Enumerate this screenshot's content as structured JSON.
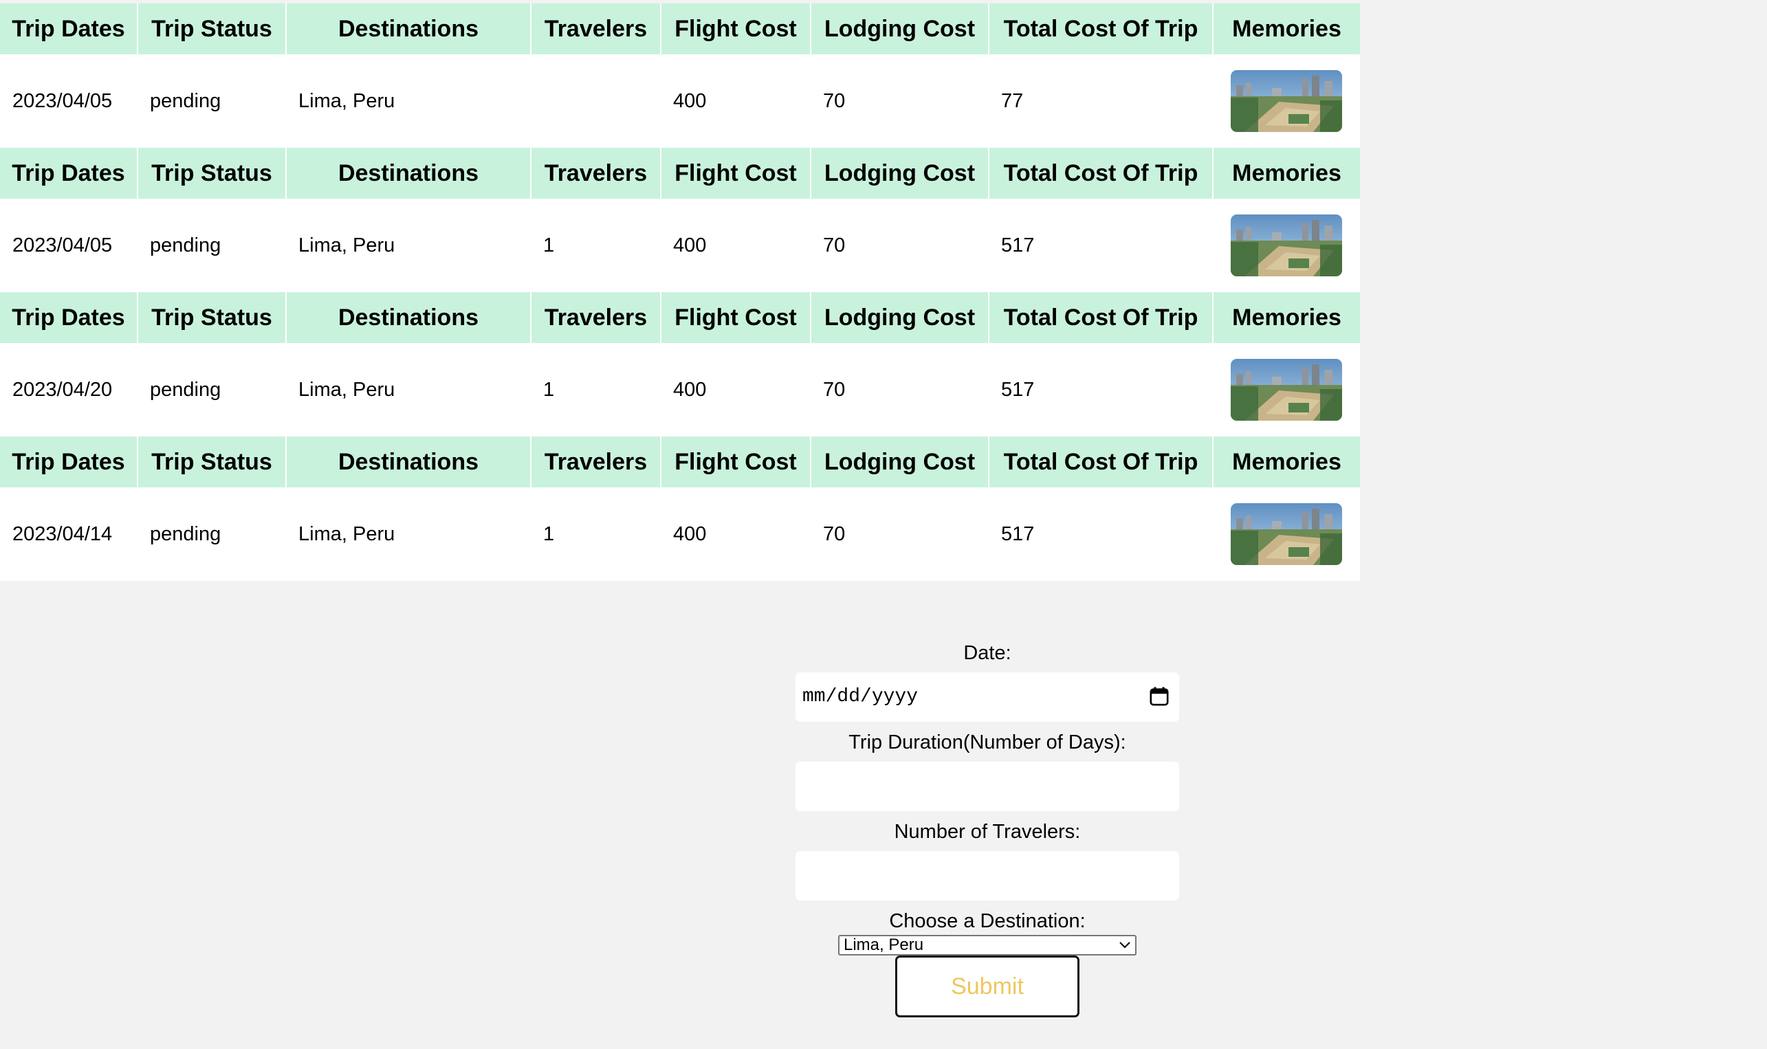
{
  "trips": {
    "headers": {
      "trip_dates": "Trip Dates",
      "trip_status": "Trip Status",
      "destinations": "Destinations",
      "travelers": "Travelers",
      "flight_cost": "Flight Cost",
      "lodging_cost": "Lodging Cost",
      "total_cost": "Total Cost Of Trip",
      "memories": "Memories"
    },
    "rows": [
      {
        "date": "2023/04/05",
        "status": "pending",
        "destination": "Lima, Peru",
        "travelers": "",
        "flight_cost": "400",
        "lodging_cost": "70",
        "total_cost": "77",
        "memory_image": "lima-city-aerial-photo"
      },
      {
        "date": "2023/04/05",
        "status": "pending",
        "destination": "Lima, Peru",
        "travelers": "1",
        "flight_cost": "400",
        "lodging_cost": "70",
        "total_cost": "517",
        "memory_image": "lima-city-aerial-photo"
      },
      {
        "date": "2023/04/20",
        "status": "pending",
        "destination": "Lima, Peru",
        "travelers": "1",
        "flight_cost": "400",
        "lodging_cost": "70",
        "total_cost": "517",
        "memory_image": "lima-city-aerial-photo"
      },
      {
        "date": "2023/04/14",
        "status": "pending",
        "destination": "Lima, Peru",
        "travelers": "1",
        "flight_cost": "400",
        "lodging_cost": "70",
        "total_cost": "517",
        "memory_image": "lima-city-aerial-photo"
      }
    ]
  },
  "form": {
    "date_label": "Date:",
    "date_placeholder": "mm/dd/yyyy",
    "duration_label": "Trip Duration(Number of Days):",
    "duration_value": "",
    "travelers_label": "Number of Travelers:",
    "travelers_value": "",
    "destination_label": "Choose a Destination:",
    "destination_selected": "Lima, Peru",
    "submit_label": "Submit"
  },
  "icons": {
    "calendar": "calendar-icon",
    "dropdown": "chevron-down-icon"
  },
  "colors": {
    "header_background": "#c8f2dc",
    "page_background": "#f2f2f2",
    "submit_text": "#efc75e"
  }
}
